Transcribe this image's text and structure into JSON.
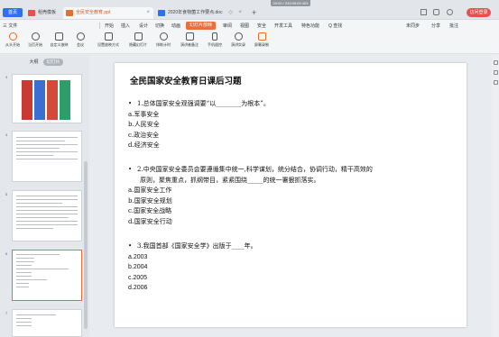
{
  "tabbar": {
    "home": "首页",
    "tabs": [
      {
        "label": "稻壳模板",
        "color": "#e84f4f"
      },
      {
        "label": "全民安全教育.ppt",
        "color": "#e07033"
      },
      {
        "label": "2020年食物菌工作要点.doc",
        "color": "#2f6ff2"
      }
    ],
    "timer": "00:00 / 233:05:00 403",
    "login": "访问登录"
  },
  "menu": {
    "file": "三 文件",
    "items": [
      "开始",
      "插入",
      "设计",
      "切换",
      "动画",
      "幻灯片放映",
      "审阅",
      "视图",
      "安全",
      "开发工具",
      "特色功能",
      "Q 查找"
    ],
    "active": "幻灯片放映",
    "right": [
      "未同步",
      "分享",
      "批注"
    ]
  },
  "ribbon": [
    {
      "label": "从头开始",
      "icon": "play-icon"
    },
    {
      "label": "当页开始",
      "icon": "play-current-icon"
    },
    {
      "label": "自定义放映",
      "icon": "custom-show-icon"
    },
    {
      "label": "会议",
      "icon": "meeting-icon"
    },
    {
      "label": "设置放映方式",
      "icon": "settings-icon"
    },
    {
      "label": "隐藏幻灯片",
      "icon": "hide-icon"
    },
    {
      "label": "排练计时",
      "icon": "timer-icon"
    },
    {
      "label": "演讲者备注",
      "icon": "notes-icon"
    },
    {
      "label": "手机遥控",
      "icon": "phone-icon"
    },
    {
      "label": "演讲实录",
      "icon": "record-icon"
    },
    {
      "label": "屏幕录制",
      "icon": "screen-record-icon"
    }
  ],
  "pane": {
    "tab_outline": "大纲",
    "tab_slides": "幻灯片",
    "slide_numbers": [
      "3",
      "4",
      "5",
      "6",
      "7"
    ]
  },
  "slide": {
    "title": "全民国家安全教育日课后习题",
    "q1": {
      "bullet": "•",
      "stem": "1.总体国家安全观强调要“以________为根本”。",
      "options": [
        "a.军事安全",
        "b.人民安全",
        "c.政治安全",
        "d.经济安全"
      ]
    },
    "q2": {
      "bullet": "•",
      "stem_line1": "2.中央国家安全委员会要遵循集中统一,科学谋划，统分结合，协调行动，精干高效的",
      "stem_line2": "原则，聚焦重点，抓纲带目，紧紧围绕_____的统一署狠抓落实。",
      "options": [
        "a.国家安全工作",
        "b.国家安全规划",
        "c.国家安全战略",
        "d.国家安全行动"
      ]
    },
    "q3": {
      "bullet": "•",
      "stem": "3.我国首部《国家安全学》出版于____年。",
      "options": [
        "a.2003",
        "b.2004",
        "c.2005",
        "d.2006"
      ]
    }
  }
}
